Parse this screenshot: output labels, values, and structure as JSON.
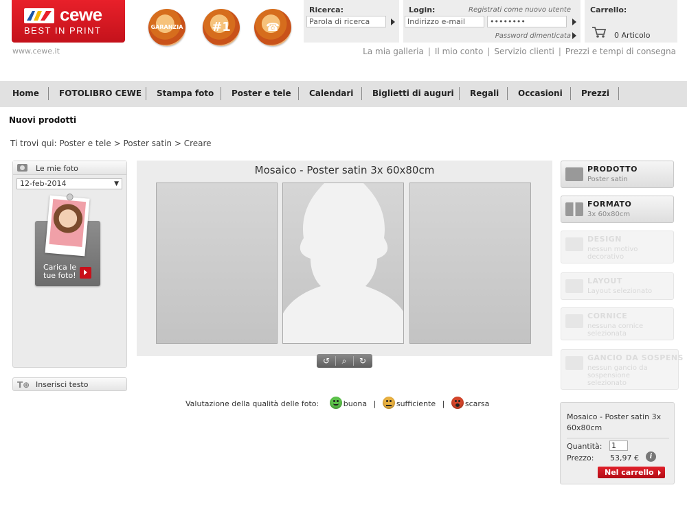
{
  "header": {
    "logo_brand": "cewe",
    "logo_tagline": "BEST IN PRINT",
    "site_url": "www.cewe.it",
    "seals": [
      "GARANZIA",
      "#1",
      "☎"
    ],
    "search": {
      "title": "Ricerca:",
      "placeholder": "Parola di ricerca"
    },
    "login": {
      "title": "Login:",
      "register_link": "Registrati come nuovo utente",
      "email_placeholder": "Indirizzo e-mail",
      "password_value": "••••••••",
      "forgot_link": "Password dimenticata"
    },
    "cart": {
      "title": "Carrello:",
      "count_label": "0 Articolo"
    },
    "top_links": [
      "La mia galleria",
      "Il mio conto",
      "Servizio clienti",
      "Prezzi e tempi di consegna"
    ]
  },
  "nav": {
    "items": [
      "Home",
      "FOTOLIBRO CEWE",
      "Stampa foto",
      "Poster e tele",
      "Calendari",
      "Biglietti di auguri",
      "Regali",
      "Occasioni",
      "Prezzi"
    ]
  },
  "page": {
    "new_products": "Nuovi prodotti",
    "breadcrumb": {
      "prefix": "Ti trovi qui:",
      "items": [
        "Poster e tele",
        "Poster satin",
        "Creare"
      ],
      "separator": ">"
    }
  },
  "left_panel": {
    "photos_title": "Le mie foto",
    "date_value": "12-feb-2014",
    "upload_label": "Carica le tue foto!",
    "insert_text_label": "Inserisci testo"
  },
  "editor": {
    "title": "Mosaico - Poster satin 3x 60x80cm",
    "tools": [
      "↺",
      "⌕",
      "↻"
    ],
    "quality": {
      "label": "Valutazione della qualità delle foto:",
      "good": "buona",
      "ok": "sufficiente",
      "bad": "scarsa",
      "separator": "|"
    }
  },
  "right_menu": [
    {
      "title": "PRODOTTO",
      "subtitle": "Poster satin",
      "enabled": true,
      "icon": "product-icon"
    },
    {
      "title": "FORMATO",
      "subtitle": "3x 60x80cm",
      "enabled": true,
      "icon": "format-grid-icon"
    },
    {
      "title": "DESIGN",
      "subtitle": "nessun motivo decorativo",
      "enabled": false,
      "icon": "butterfly-icon"
    },
    {
      "title": "LAYOUT",
      "subtitle": "Layout selezionato",
      "enabled": false,
      "icon": "layout-icon"
    },
    {
      "title": "CORNICE",
      "subtitle": "nessuna cornice selezionata",
      "enabled": false,
      "icon": "frame-icon"
    },
    {
      "title": "GANCIO DA SOSPENS",
      "subtitle": "nessun gancio da sospensione selezionato",
      "enabled": false,
      "icon": "hammer-icon"
    }
  ],
  "order": {
    "product_name": "Mosaico - Poster satin 3x 60x80cm",
    "quantity_label": "Quantità:",
    "quantity_value": "1",
    "price_label": "Prezzo:",
    "price_value": "53,97 €",
    "info": "i",
    "cart_button": "Nel carrello"
  },
  "colors": {
    "brand_red": "#d9161f",
    "nav_bg": "#e1e1e1",
    "panel_bg": "#ececec"
  }
}
